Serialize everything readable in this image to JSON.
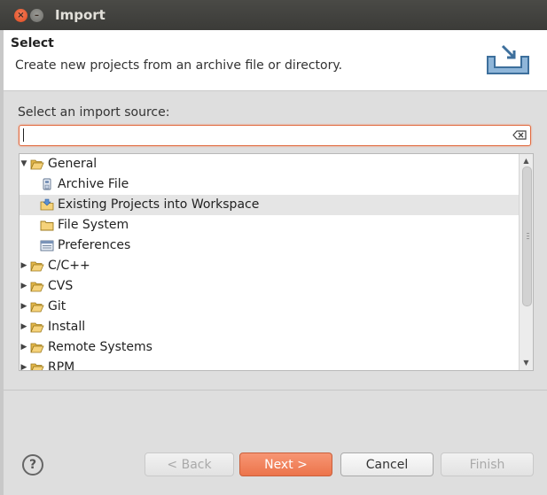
{
  "window": {
    "title": "Import"
  },
  "header": {
    "heading": "Select",
    "description": "Create new projects from an archive file or directory."
  },
  "source": {
    "label": "Select an import source:",
    "filter_value": "",
    "filter_placeholder": ""
  },
  "tree": {
    "items": [
      {
        "label": "General",
        "level": 0,
        "expanded": true,
        "icon": "folder-open-icon"
      },
      {
        "label": "Archive File",
        "level": 1,
        "icon": "archive-file-icon"
      },
      {
        "label": "Existing Projects into Workspace",
        "level": 1,
        "icon": "existing-projects-icon",
        "selected": true
      },
      {
        "label": "File System",
        "level": 1,
        "icon": "folder-icon"
      },
      {
        "label": "Preferences",
        "level": 1,
        "icon": "preferences-icon"
      },
      {
        "label": "C/C++",
        "level": 0,
        "expanded": false,
        "icon": "folder-open-icon"
      },
      {
        "label": "CVS",
        "level": 0,
        "expanded": false,
        "icon": "folder-open-icon"
      },
      {
        "label": "Git",
        "level": 0,
        "expanded": false,
        "icon": "folder-open-icon"
      },
      {
        "label": "Install",
        "level": 0,
        "expanded": false,
        "icon": "folder-open-icon"
      },
      {
        "label": "Remote Systems",
        "level": 0,
        "expanded": false,
        "icon": "folder-open-icon"
      },
      {
        "label": "RPM",
        "level": 0,
        "expanded": false,
        "icon": "folder-open-icon"
      }
    ]
  },
  "buttons": {
    "back": "< Back",
    "next": "Next >",
    "cancel": "Cancel",
    "finish": "Finish",
    "help": "?"
  },
  "colors": {
    "accent": "#ec744b",
    "titlebar": "#3e3e3b",
    "selection": "#e5e5e5"
  }
}
